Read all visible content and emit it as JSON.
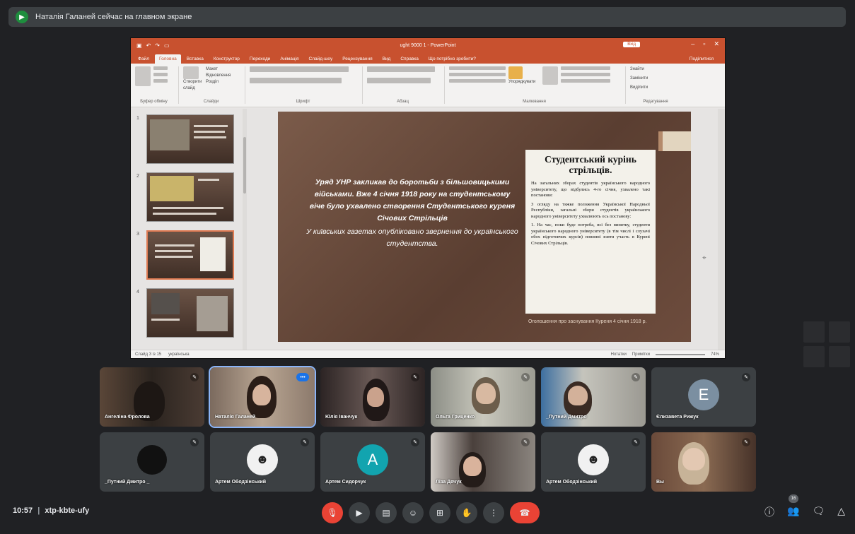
{
  "banner": {
    "icon": "present-icon",
    "text": "Наталія Галаней сейчас на главном экране"
  },
  "ppt": {
    "doc_title": "ught 9000 1 - PowerPoint",
    "signin": "Вхід",
    "tabs": [
      "Файл",
      "Головна",
      "Вставка",
      "Конструктор",
      "Переходи",
      "Анімація",
      "Слайд-шоу",
      "Рецензування",
      "Вид",
      "Справка",
      "Що потрібно зробити?"
    ],
    "share": "Поділитися",
    "ribbon_groups": [
      "Буфер обміну",
      "Слайди",
      "Шрифт",
      "Абзац",
      "Малювання",
      "Редагування"
    ],
    "ribbon_items": {
      "new_slide": "Створити слайд",
      "layout": "Макет",
      "reset": "Відновлення",
      "section": "Розділ",
      "arrange": "Упорядкувати",
      "find": "Знайти",
      "replace": "Замінити",
      "select": "Виділити"
    },
    "thumb_numbers": [
      "1",
      "2",
      "3",
      "4"
    ],
    "status_left": "Слайд 3 із 15",
    "status_lang": "українська",
    "status_notes": "Нотатки",
    "status_comments": "Примітки",
    "zoom": "74%"
  },
  "slide": {
    "para1": "Уряд УНР закликав до боротьби з більшовицькими військами. Вже 4 січня 1918 року на студентському віче було ухвалено створення Студентського куреня Січових Стрільців",
    "para2": "У київських газетах опубліковано звернення до українського студентства.",
    "news_head": "Студентський курінь стрільців.",
    "news_body1": "На загальних зборах студентів українського народного університету, що відбулись 4-го січня, ухвалено такі постанови:",
    "news_body2": "З огляду на тяжке положення Української Народньої Республіки, загальні збори студентів українського народного університету ухвалюють ось постанову:",
    "news_body3": "1. На час, поки буде потреба, всі без винятку, студенти українського народного університету (в тім числі і слухачі обох підготовчих курсів) повинні взяти участь в Курені Січових Стрільців.",
    "caption": "Оголошення про заснування Куреня 4 січня 1918 р."
  },
  "participants": [
    {
      "name": "Ангеліна Фролова",
      "muted": true
    },
    {
      "name": "Наталія Галаней",
      "muted": false
    },
    {
      "name": "Юлія Іванчук",
      "muted": true
    },
    {
      "name": "Ольга Гриценко",
      "muted": true
    },
    {
      "name": "_Путний Дмитро",
      "muted": true
    },
    {
      "name": "Єлизавета Рижук",
      "muted": true,
      "initial": "Е",
      "color": "#7b8fa1"
    },
    {
      "name": "_Путний Дмитро _",
      "muted": true
    },
    {
      "name": "Артем Ободзінський",
      "muted": true
    },
    {
      "name": "Артем Сидорчук",
      "muted": true,
      "initial": "A",
      "color": "#12a4af"
    },
    {
      "name": "Ліза Дячук",
      "muted": true
    },
    {
      "name": "Артем Ободзінський",
      "muted": true
    },
    {
      "name": "Вы",
      "muted": true
    }
  ],
  "bottom": {
    "time": "10:57",
    "separator": "|",
    "meeting_code": "xtp-kbte-ufy",
    "participant_count": "16"
  },
  "colors": {
    "ppt_accent": "#c8512f",
    "meet_bg": "#202124",
    "red": "#ea4335",
    "active_outline": "#8ab4f8"
  }
}
